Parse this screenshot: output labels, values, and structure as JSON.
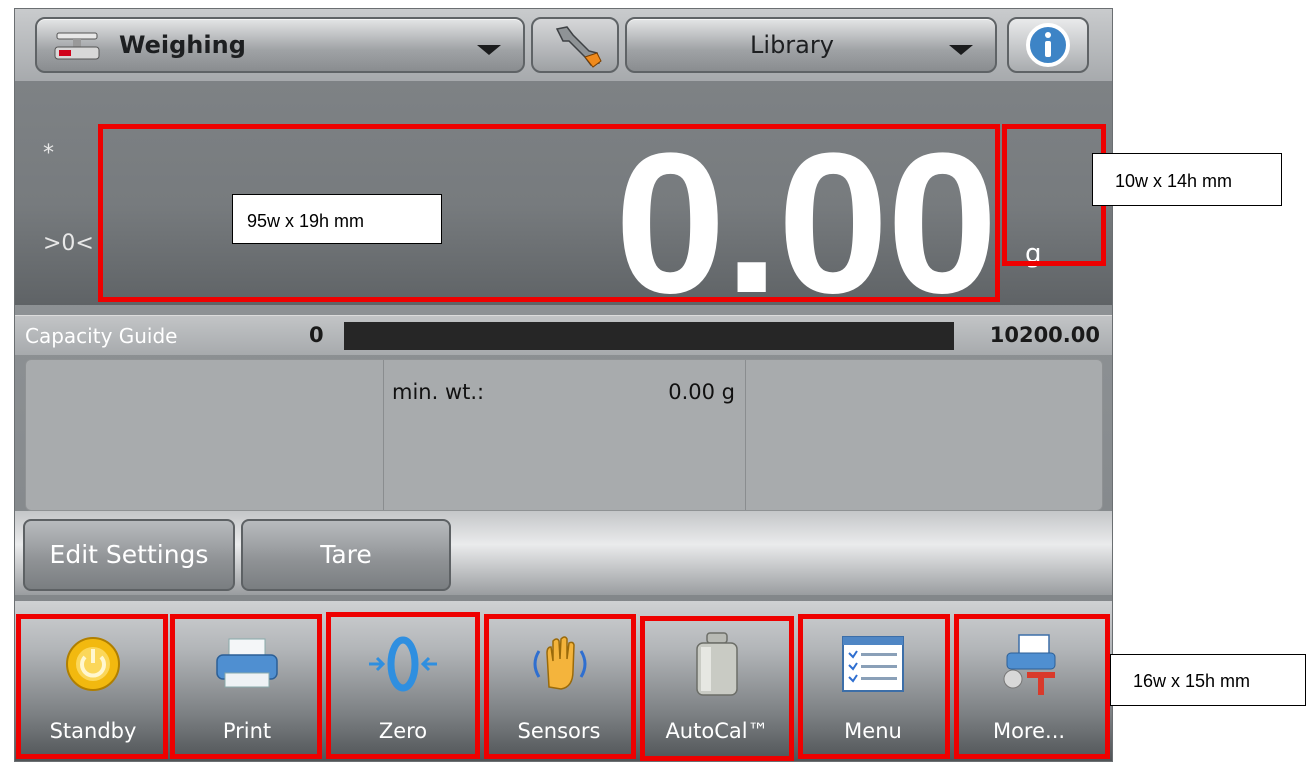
{
  "topbar": {
    "app_label": "Weighing",
    "library_label": "Library",
    "icons": [
      "scale-icon",
      "wrench-icon",
      "info-icon"
    ]
  },
  "display": {
    "stable_flag": "*",
    "zero_flag": ">0<",
    "weight_value": "0.00",
    "unit": "g"
  },
  "capacity": {
    "label": "Capacity Guide",
    "min": "0",
    "max": "10200.00",
    "fill_fraction": 0
  },
  "info_panel": {
    "min_wt_label": "min. wt.:",
    "min_wt_value": "0.00 g"
  },
  "softkeys": {
    "edit_settings": "Edit Settings",
    "tare": "Tare"
  },
  "toolbar": {
    "items": [
      {
        "label": "Standby",
        "icon": "power-icon"
      },
      {
        "label": "Print",
        "icon": "printer-icon"
      },
      {
        "label": "Zero",
        "icon": "zero-icon"
      },
      {
        "label": "Sensors",
        "icon": "hand-sensor-icon"
      },
      {
        "label": "AutoCal™",
        "icon": "calibration-weight-icon"
      },
      {
        "label": "Menu",
        "icon": "menu-list-icon"
      },
      {
        "label": "More...",
        "icon": "more-icon"
      }
    ]
  },
  "annotations": {
    "display_size": "95w x 19h mm",
    "unit_size": "10w x 14h mm",
    "button_size": "16w x 15h mm"
  },
  "colors": {
    "highlight": "#ee0000",
    "display_text": "#ffffff",
    "capacity_bar": "#262626"
  }
}
